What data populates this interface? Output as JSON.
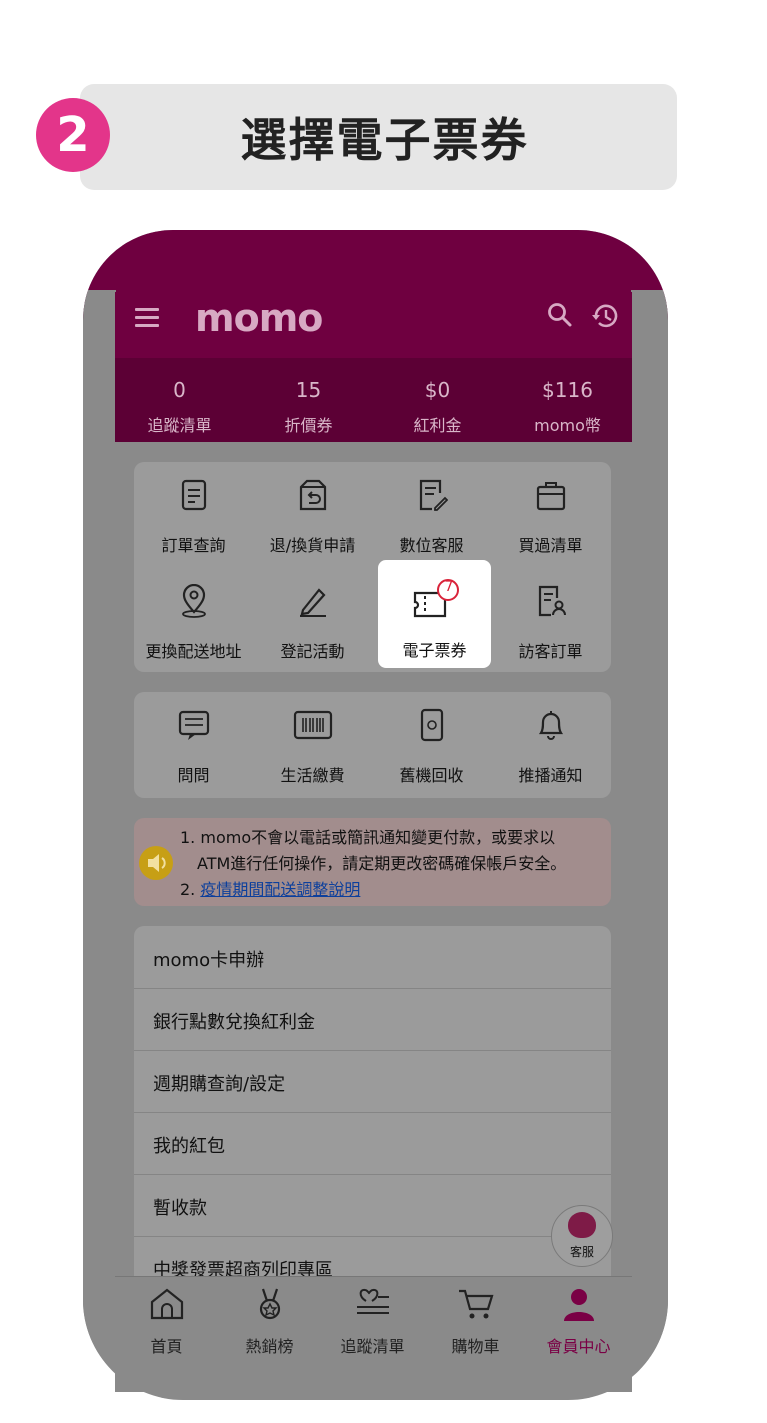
{
  "step": {
    "number": "2",
    "title": "選擇電子票券"
  },
  "appbar": {
    "logo": "momo"
  },
  "stats": [
    {
      "value": "0",
      "label": "追蹤清單"
    },
    {
      "value": "15",
      "label": "折價券"
    },
    {
      "value": "$0",
      "label": "紅利金"
    },
    {
      "value": "$116",
      "label": "momo幣"
    }
  ],
  "grid": [
    {
      "label": "訂單查詢",
      "icon": "document-icon"
    },
    {
      "label": "退/換貨申請",
      "icon": "return-box-icon"
    },
    {
      "label": "數位客服",
      "icon": "edit-document-icon"
    },
    {
      "label": "買過清單",
      "icon": "bag-icon"
    },
    {
      "label": "更換配送地址",
      "icon": "location-pin-icon"
    },
    {
      "label": "登記活動",
      "icon": "pencil-icon"
    },
    {
      "label": "電子票券",
      "icon": "ticket-icon",
      "badge": "7"
    },
    {
      "label": "訪客訂單",
      "icon": "visitor-order-icon"
    }
  ],
  "grid2": [
    {
      "label": "問問",
      "icon": "chat-icon"
    },
    {
      "label": "生活繳費",
      "icon": "barcode-icon"
    },
    {
      "label": "舊機回收",
      "icon": "recycle-phone-icon"
    },
    {
      "label": "推播通知",
      "icon": "bell-icon"
    }
  ],
  "notice": {
    "line1": "1. momo不會以電話或簡訊通知變更付款，或要求以",
    "line2": "ATM進行任何操作，請定期更改密碼確保帳戶安全。",
    "line3_prefix": "2. ",
    "line3_link": "疫情期間配送調整說明"
  },
  "list": [
    "momo卡申辦",
    "銀行點數兌換紅利金",
    "週期購查詢/設定",
    "我的紅包",
    "暫收款",
    "中獎發票超商列印專區"
  ],
  "fab": {
    "label": "客服"
  },
  "tabs": [
    {
      "label": "首頁",
      "icon": "home-icon"
    },
    {
      "label": "熱銷榜",
      "icon": "medal-icon"
    },
    {
      "label": "追蹤清單",
      "icon": "heart-list-icon"
    },
    {
      "label": "購物車",
      "icon": "cart-icon"
    },
    {
      "label": "會員中心",
      "icon": "person-icon",
      "active": true
    }
  ],
  "colors": {
    "brand": "#6f0040",
    "step": "#e3358a",
    "active_tab": "#7a0045"
  }
}
